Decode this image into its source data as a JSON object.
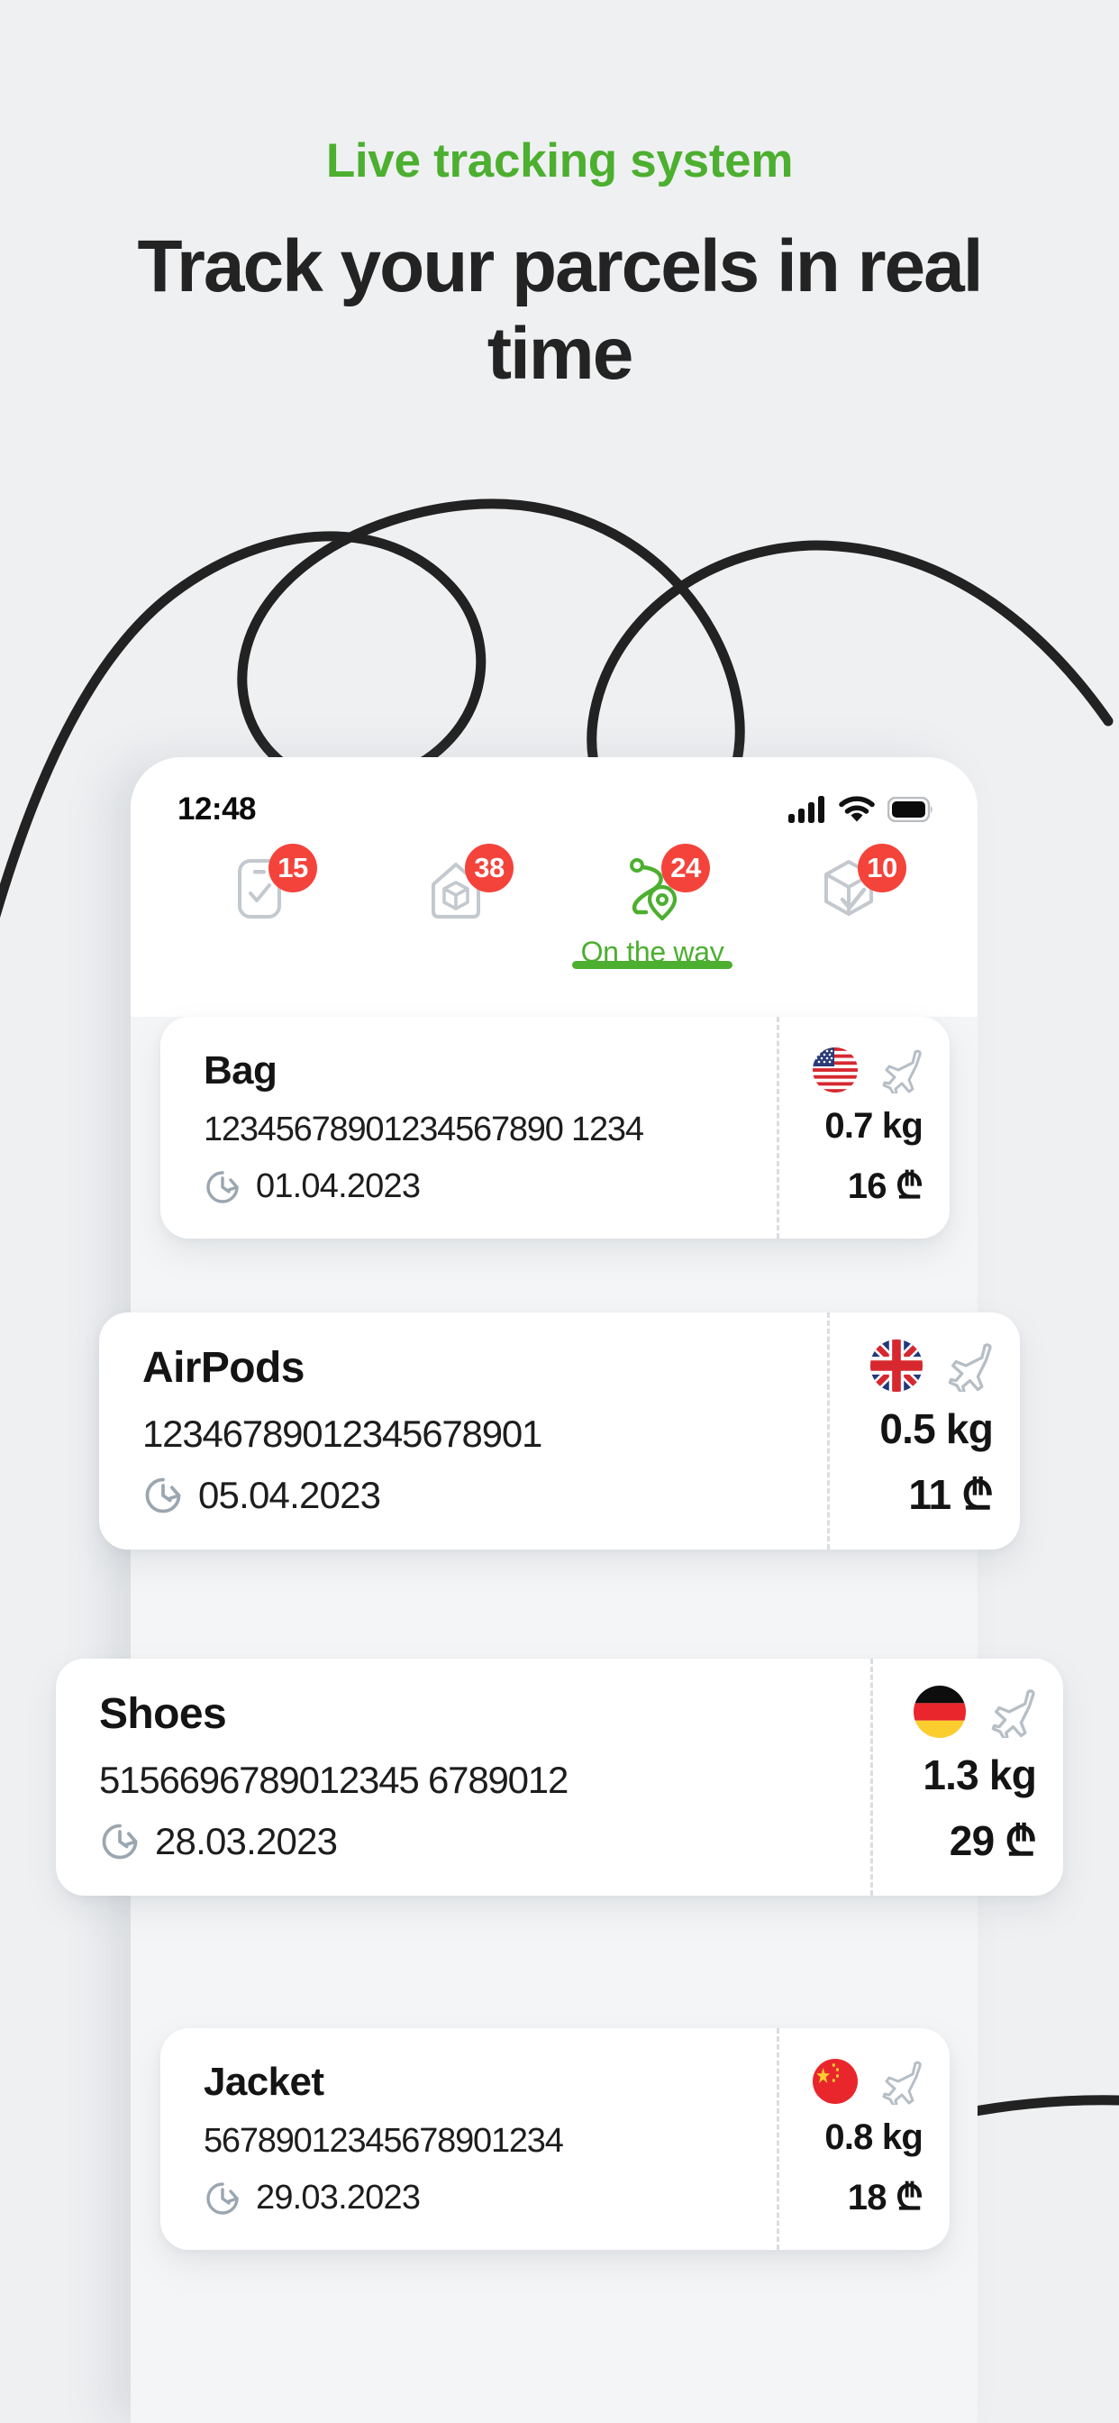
{
  "header": {
    "eyebrow": "Live tracking system",
    "headline": "Track your parcels in real time",
    "eyebrow_color": "#4CAF2F",
    "headline_color": "#232323"
  },
  "background_color": "#EFF0F2",
  "accent_color": "#4CAF2F",
  "badge_color": "#F4433B",
  "phone": {
    "statusbar": {
      "time": "12:48",
      "icons": [
        "cellular-signal-icon",
        "wifi-icon",
        "battery-icon"
      ]
    },
    "tabs": [
      {
        "icon": "phone-check-icon",
        "badge": "15",
        "label": "",
        "active": false
      },
      {
        "icon": "warehouse-box-icon",
        "badge": "38",
        "label": "",
        "active": false
      },
      {
        "icon": "route-pin-icon",
        "badge": "24",
        "label": "On the way",
        "active": true
      },
      {
        "icon": "package-check-icon",
        "badge": "10",
        "label": "",
        "active": false
      }
    ]
  },
  "parcels": [
    {
      "title": "Bag",
      "tracking": "12345678901234567890 1234",
      "date": "01.04.2023",
      "flag": "us",
      "transport_icon": "airplane-icon",
      "weight": "0.7 kg",
      "price": "16 ₾",
      "date_icon": "clock-history-icon"
    },
    {
      "title": "AirPods",
      "tracking": "12346789012345678901",
      "date": "05.04.2023",
      "flag": "gb",
      "transport_icon": "airplane-icon",
      "weight": "0.5 kg",
      "price": "11 ₾",
      "date_icon": "clock-history-icon"
    },
    {
      "title": "Shoes",
      "tracking": "5156696789012345 6789012",
      "date": "28.03.2023",
      "flag": "de",
      "transport_icon": "airplane-icon",
      "weight": "1.3 kg",
      "price": "29 ₾",
      "date_icon": "clock-history-icon"
    },
    {
      "title": "Jacket",
      "tracking": "56789012345678901234",
      "date": "29.03.2023",
      "flag": "cn",
      "transport_icon": "airplane-icon",
      "weight": "0.8 kg",
      "price": "18 ₾",
      "date_icon": "clock-history-icon"
    }
  ]
}
